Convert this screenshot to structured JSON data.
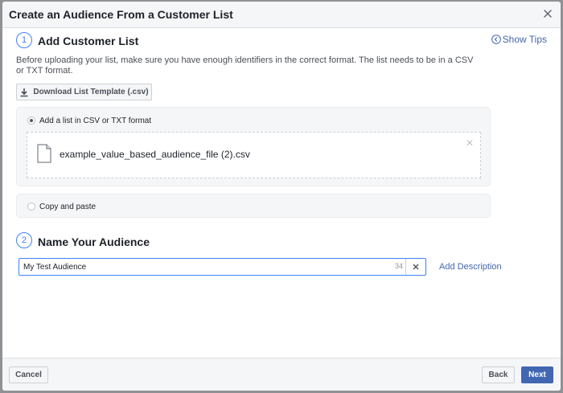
{
  "dialog": {
    "title": "Create an Audience From a Customer List",
    "close_icon": "close-icon"
  },
  "step1": {
    "number": "1",
    "title": "Add Customer List",
    "show_tips": "Show Tips",
    "description": "Before uploading your list, make sure you have enough identifiers in the correct format. The list needs to be in a CSV or TXT format.",
    "download_button": "Download List Template (.csv)",
    "option_file": {
      "label": "Add a list in CSV or TXT format",
      "selected": true,
      "file_name": "example_value_based_audience_file (2).csv"
    },
    "option_paste": {
      "label": "Copy and paste",
      "selected": false
    }
  },
  "step2": {
    "number": "2",
    "title": "Name Your Audience",
    "audience_name": "My Test Audience",
    "char_count": "34",
    "add_description": "Add Description"
  },
  "footer": {
    "cancel": "Cancel",
    "back": "Back",
    "next": "Next"
  },
  "colors": {
    "accent": "#4267b2",
    "focus": "#4080ff"
  }
}
